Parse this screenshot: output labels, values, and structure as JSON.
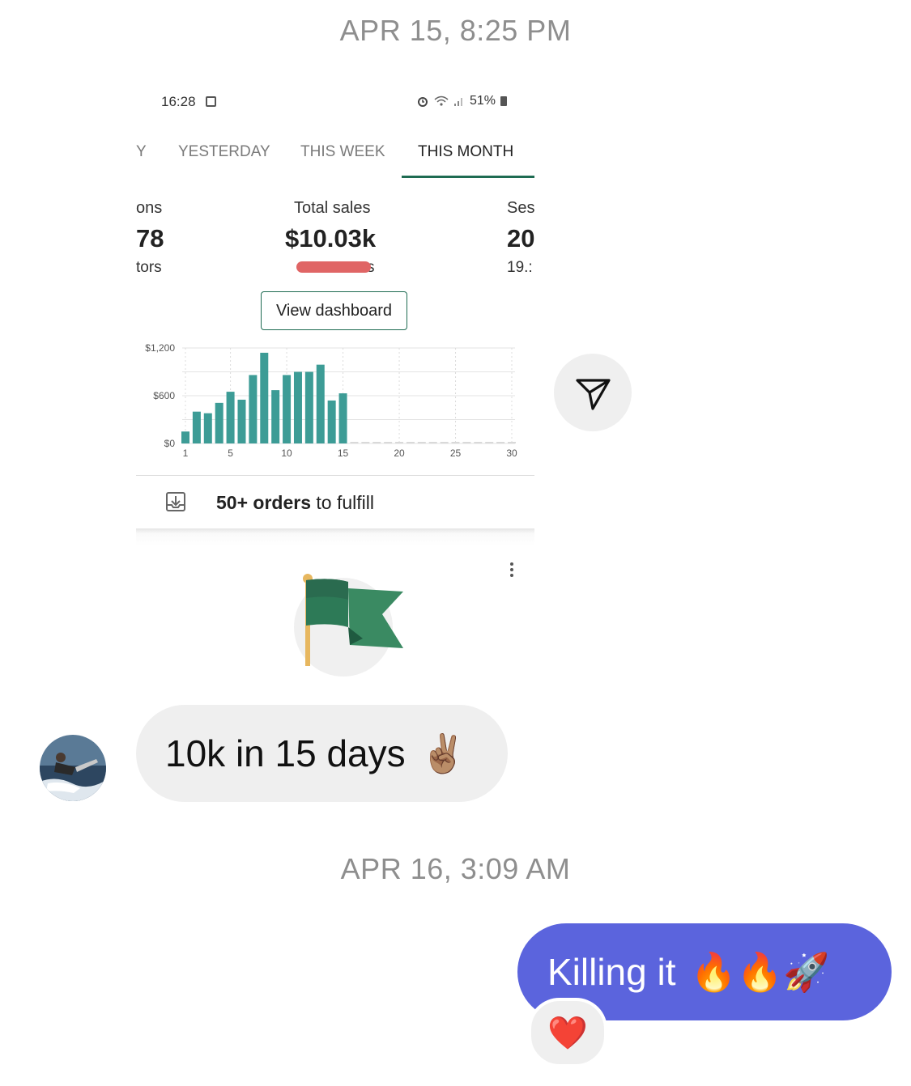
{
  "timestamps": {
    "first": "APR 15, 8:25 PM",
    "second": "APR 16, 3:09 AM"
  },
  "screenshot": {
    "status_bar": {
      "time": "16:28",
      "battery": "51%"
    },
    "tabs": [
      {
        "label": "Y",
        "active": false
      },
      {
        "label": "YESTERDAY",
        "active": false
      },
      {
        "label": "THIS WEEK",
        "active": false
      },
      {
        "label": "THIS MONTH",
        "active": true
      }
    ],
    "stats": {
      "left": {
        "label": "ons",
        "value": "78",
        "sub": "tors"
      },
      "center": {
        "label": "Total sales",
        "value": "$10.03k",
        "sub": "s"
      },
      "right": {
        "label": "Ses",
        "value": "20",
        "sub": "19.:"
      }
    },
    "dashboard_button": "View dashboard",
    "orders": {
      "bold": "50+ orders",
      "rest": " to fulfill"
    },
    "accent_color": "#1e6b52",
    "bar_color": "#3d9c96"
  },
  "chart_data": {
    "type": "bar",
    "yticks": [
      "$1,200",
      "$600",
      "$0"
    ],
    "xticks": [
      "1",
      "5",
      "10",
      "15",
      "20",
      "25",
      "30"
    ],
    "ylim": [
      0,
      1200
    ],
    "x": [
      1,
      2,
      3,
      4,
      5,
      6,
      7,
      8,
      9,
      10,
      11,
      12,
      13,
      14,
      15,
      16,
      17,
      18,
      19,
      20,
      21,
      22,
      23,
      24,
      25,
      26,
      27,
      28,
      29,
      30
    ],
    "values": [
      150,
      400,
      380,
      510,
      650,
      550,
      860,
      1140,
      670,
      860,
      900,
      900,
      990,
      540,
      630,
      0,
      0,
      0,
      0,
      0,
      0,
      0,
      0,
      0,
      0,
      0,
      0,
      0,
      0,
      0
    ]
  },
  "messages": {
    "incoming": "10k in 15 days",
    "incoming_emoji": "✌🏽",
    "outgoing": "Killing it",
    "outgoing_emoji": "🔥🔥🚀",
    "reaction": "❤️"
  },
  "colors": {
    "outgoing_bubble": "#5b64dd",
    "incoming_bubble": "#efefef"
  }
}
